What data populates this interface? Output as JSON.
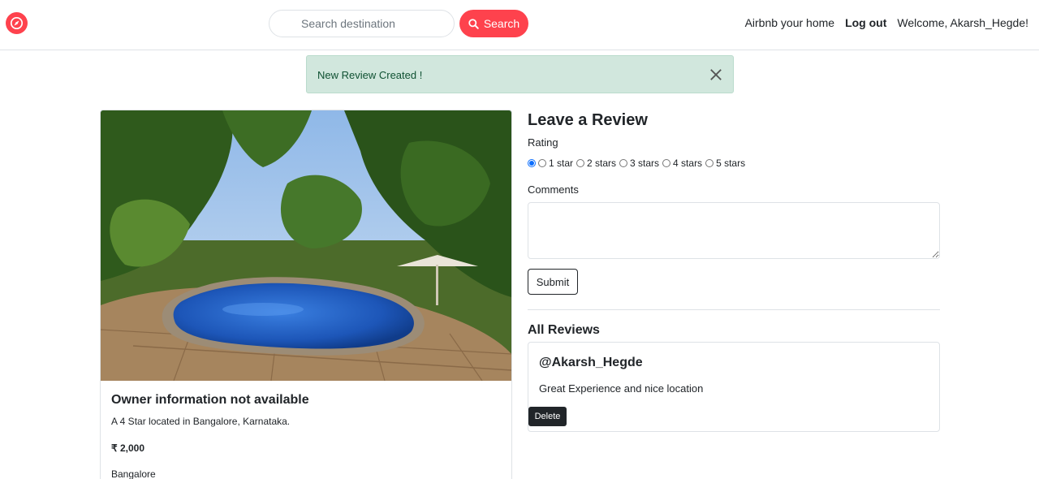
{
  "navbar": {
    "logo_icon": "compass-icon",
    "search_placeholder": "Search destination",
    "search_button": "Search",
    "host_link": "Airbnb your home",
    "logout": "Log out",
    "welcome": "Welcome, Akarsh_Hegde!"
  },
  "alert": {
    "message": "New Review Created !",
    "close_icon": "close-icon"
  },
  "listing": {
    "title": "Owner information not available",
    "description": "A 4 Star located in Bangalore, Karnataka.",
    "price": "₹ 2,000",
    "location": "Bangalore"
  },
  "review_form": {
    "heading": "Leave a Review",
    "rating_label": "Rating",
    "rating_options": [
      "1 star",
      "2 stars",
      "3 stars",
      "4 stars",
      "5 stars"
    ],
    "comments_label": "Comments",
    "comments_value": "",
    "submit_label": "Submit"
  },
  "reviews": {
    "heading": "All Reviews",
    "items": [
      {
        "author": "@Akarsh_Hegde",
        "comment": "Great Experience and nice location",
        "delete_label": "Delete"
      }
    ]
  },
  "colors": {
    "brand": "#fe424d",
    "alert_bg": "#d1e7dd",
    "alert_text": "#0f5132",
    "dark": "#212529"
  }
}
